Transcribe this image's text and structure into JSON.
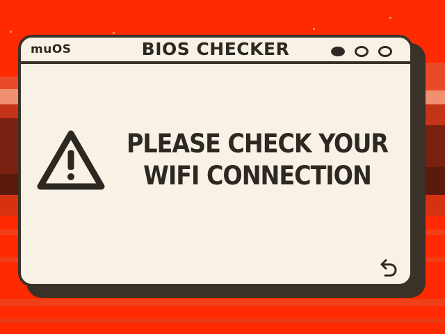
{
  "window": {
    "brand": "muOS",
    "title": "BIOS CHECKER",
    "controls": [
      "minimize",
      "restore",
      "close"
    ]
  },
  "message": {
    "line1": "PLEASE CHECK YOUR",
    "line2": "WIFI CONNECTION"
  },
  "icons": {
    "alert": "warning-triangle-icon",
    "back": "back-arrow-icon"
  },
  "colors": {
    "background": "#ff2a00",
    "window": "#f8f2e6",
    "ink": "#2d2821"
  }
}
